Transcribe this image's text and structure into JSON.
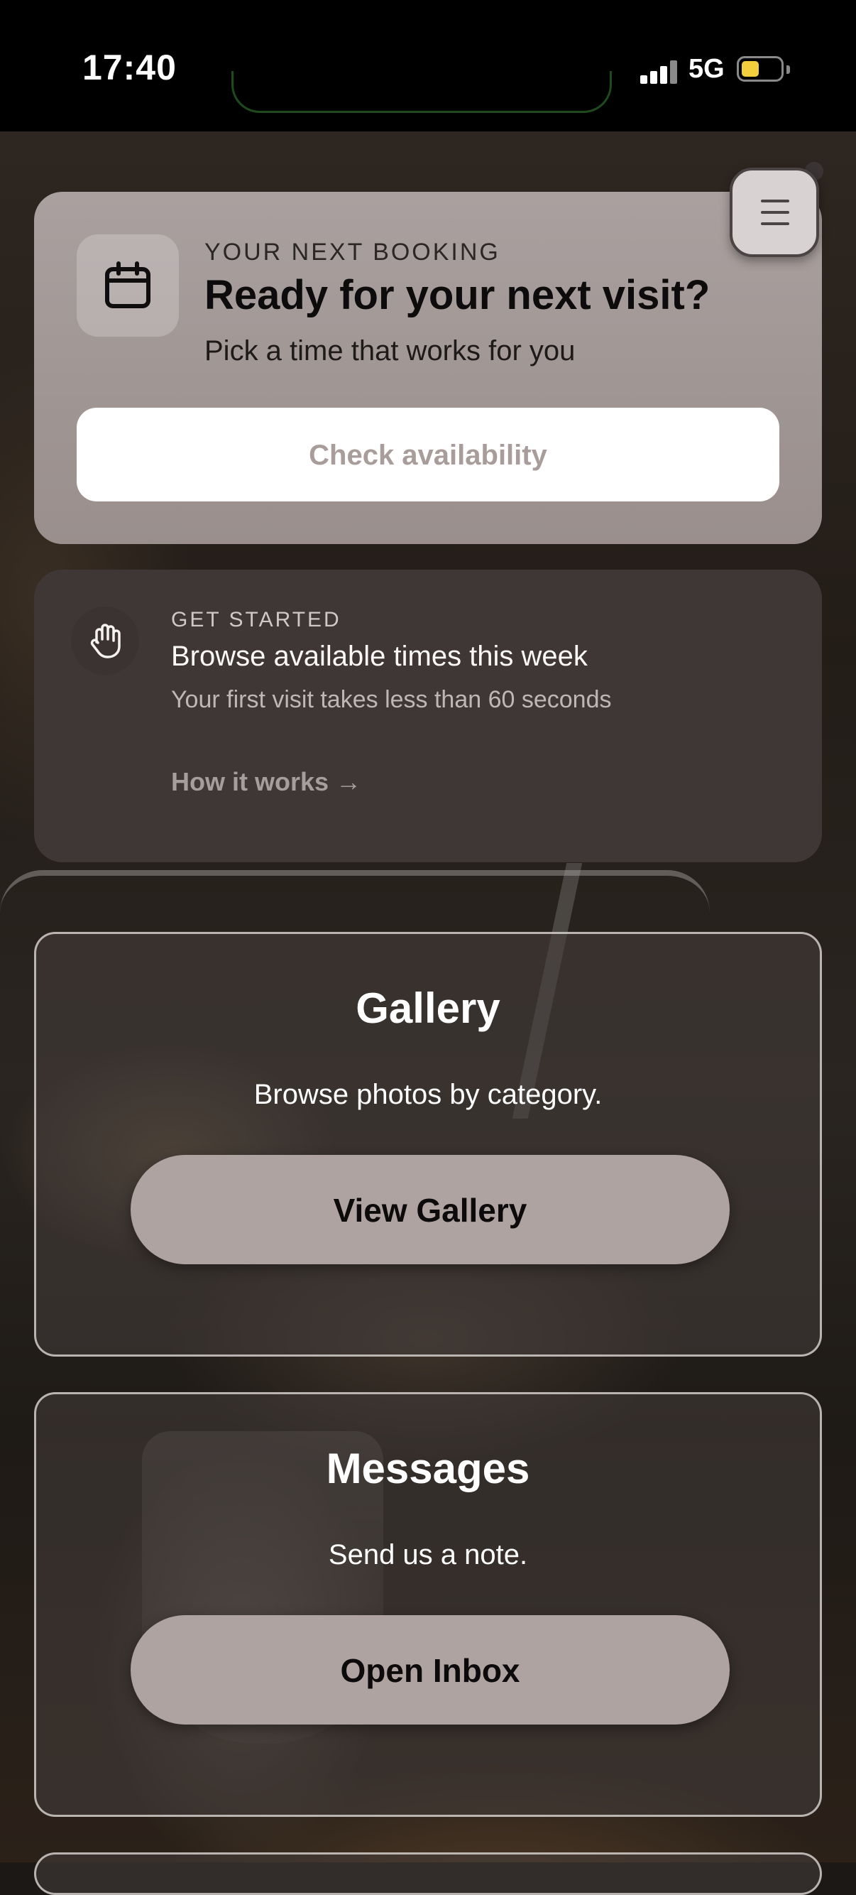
{
  "status_bar": {
    "time": "17:40",
    "network": "5G"
  },
  "booking": {
    "eyebrow": "YOUR NEXT BOOKING",
    "title": "Ready for your next visit?",
    "subtitle": "Pick a time that works for you",
    "cta_label": "Check availability",
    "icon": "calendar-icon"
  },
  "get_started": {
    "eyebrow": "GET STARTED",
    "title": "Browse available times this week",
    "subtitle": "Your first visit takes less than 60 seconds",
    "link_label": "How it works →",
    "icon": "hand-icon"
  },
  "gallery": {
    "title": "Gallery",
    "subtitle": "Browse photos by category.",
    "button_label": "View Gallery"
  },
  "messages": {
    "title": "Messages",
    "subtitle": "Send us a note.",
    "button_label": "Open Inbox"
  },
  "menu": {
    "icon": "hamburger-menu-icon"
  },
  "colors": {
    "booking_card": "#a69c9a",
    "started_card": "#3e3736",
    "pill_button": "#afa3a1",
    "battery": "#f2cf3d"
  }
}
